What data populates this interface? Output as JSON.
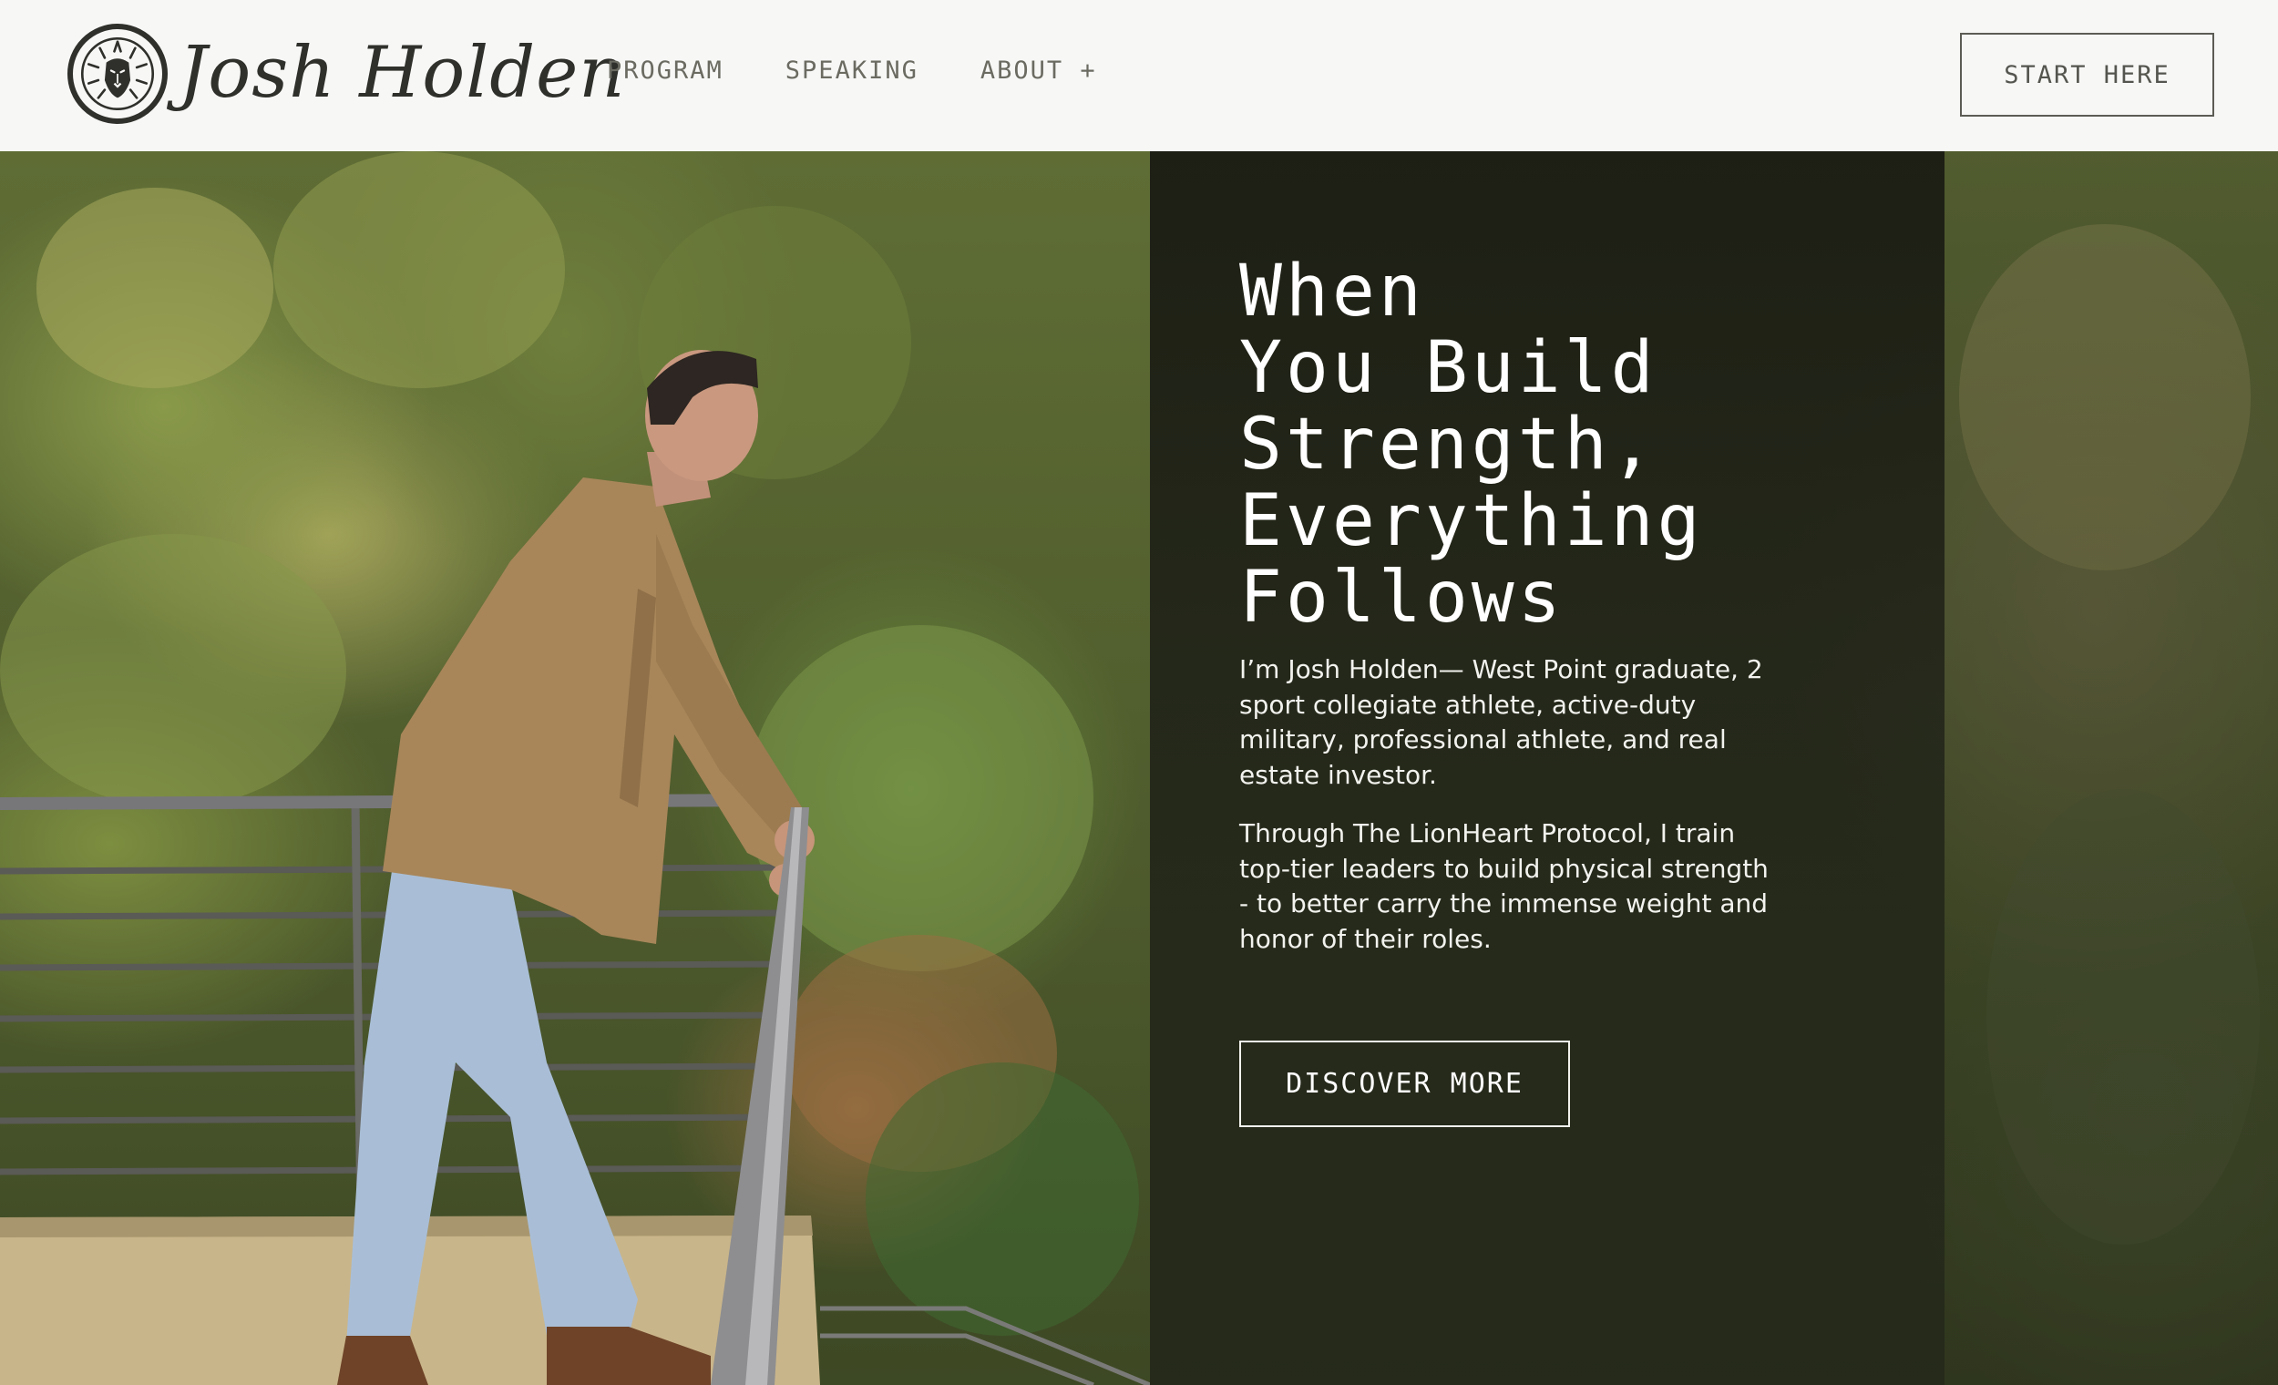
{
  "header": {
    "logo_icon": "lion-head-icon",
    "brand_name": "Josh Holden",
    "nav": [
      {
        "label": "PROGRAM"
      },
      {
        "label": "SPEAKING"
      },
      {
        "label": "ABOUT +"
      }
    ],
    "cta_label": "START HERE"
  },
  "hero": {
    "headline_lines": [
      "When",
      "You Build",
      "Strength,",
      "Everything",
      "Follows"
    ],
    "bio_paragraphs": [
      "I’m Josh Holden— West Point graduate, 2 sport collegiate athlete, active-duty military, professional athlete, and real estate investor.",
      "Through The LionHeart Protocol, I train top-tier leaders to build physical strength - to better carry the immense weight and honor of their roles."
    ],
    "cta_label": "DISCOVER MORE",
    "image": "man-leaning-on-railing-forest-photo"
  },
  "colors": {
    "header_bg": "#f7f7f6",
    "ink": "#2f2f2b",
    "nav_text": "#6b6b62",
    "panel_overlay": "#1c1e16",
    "hero_text": "#ffffff"
  }
}
